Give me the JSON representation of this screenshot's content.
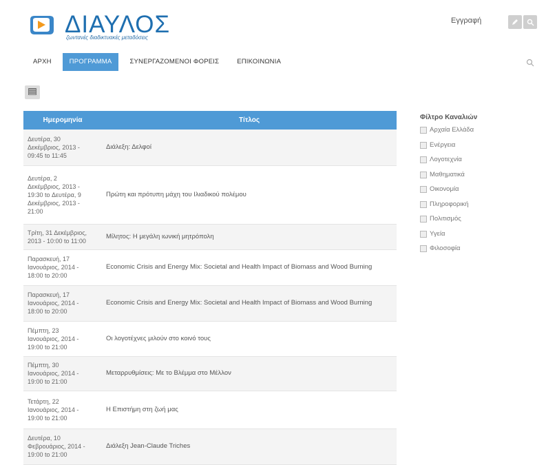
{
  "header": {
    "logo_title": "ΔΙΑΥΛΟΣ",
    "logo_subtitle": "ζωντανές διαδικτυακές μεταδόσεις",
    "register_link": "Εγγραφή",
    "brand_color": "#1f6fb0",
    "icons": [
      "edit-icon",
      "search-icon"
    ]
  },
  "nav": {
    "items": [
      "ΑΡΧΗ",
      "ΠΡΟΓΡΑΜΜΑ",
      "ΣΥΝΕΡΓΑΖΟΜΕΝΟΙ ΦΟΡΕΙΣ",
      "ΕΠΙΚΟΙΝΩΝΙΑ"
    ],
    "active": "ΠΡΟΓΡΑΜΜΑ",
    "active_color": "#4f9ad6"
  },
  "table": {
    "headers": [
      "Ημερομηνία",
      "Τίτλος"
    ],
    "rows": [
      {
        "date": [
          "Δευτέρα, 30",
          "Δεκέμβριος, 2013 -",
          "09:45 to 11:45"
        ],
        "title": "Διάλεξη: Δελφοί"
      },
      {
        "date": [
          "Δευτέρα, 2",
          "Δεκέμβριος, 2013 -",
          "19:30 to Δευτέρα, 9",
          "Δεκέμβριος, 2013 -",
          "21:00"
        ],
        "title": "Πρώτη και πρότυπη μάχη του Ιλιαδικού πολέμου"
      },
      {
        "date": [
          "Τρίτη, 31 Δεκέμβριος,",
          "2013 - 10:00 to 11:00"
        ],
        "title": "Μίλητος: Η μεγάλη ιωνική μητρόπολη"
      },
      {
        "date": [
          "Παρασκευή, 17",
          "Ιανουάριος, 2014 -",
          "18:00 to 20:00"
        ],
        "title": "Economic Crisis and Energy Mix: Societal and Health Impact of Biomass and Wood Burning"
      },
      {
        "date": [
          "Παρασκευή, 17",
          "Ιανουάριος, 2014 -",
          "18:00 to 20:00"
        ],
        "title": "Economic Crisis and Energy Mix: Societal and Health Impact of Biomass and Wood Burning"
      },
      {
        "date": [
          "Πέμπτη, 23",
          "Ιανουάριος, 2014 -",
          "19:00 to 21:00"
        ],
        "title": "Οι λογοτέχνες μιλούν στο κοινό τους"
      },
      {
        "date": [
          "Πέμπτη, 30",
          "Ιανουάριος, 2014 -",
          "19:00 to 21:00"
        ],
        "title": "Μεταρρυθμίσεις: Με το Βλέμμα στο Μέλλον"
      },
      {
        "date": [
          "Τετάρτη, 22",
          "Ιανουάριος, 2014 -",
          "19:00 to 21:00"
        ],
        "title": "Η Επιστήμη στη ζωή μας"
      },
      {
        "date": [
          "Δευτέρα, 10",
          "Φεβρουάριος, 2014 -",
          "19:00 to 21:00"
        ],
        "title": "Διάλεξη Jean-Claude Triches"
      }
    ]
  },
  "filter": {
    "title": "Φίλτρο Καναλιών",
    "items": [
      "Αρχαία Ελλάδα",
      "Ενέργεια",
      "Λογοτεχνία",
      "Μαθηματικά",
      "Οικονομία",
      "Πληροφορική",
      "Πολιτισμός",
      "Υγεία",
      "Φιλοσοφία"
    ]
  }
}
